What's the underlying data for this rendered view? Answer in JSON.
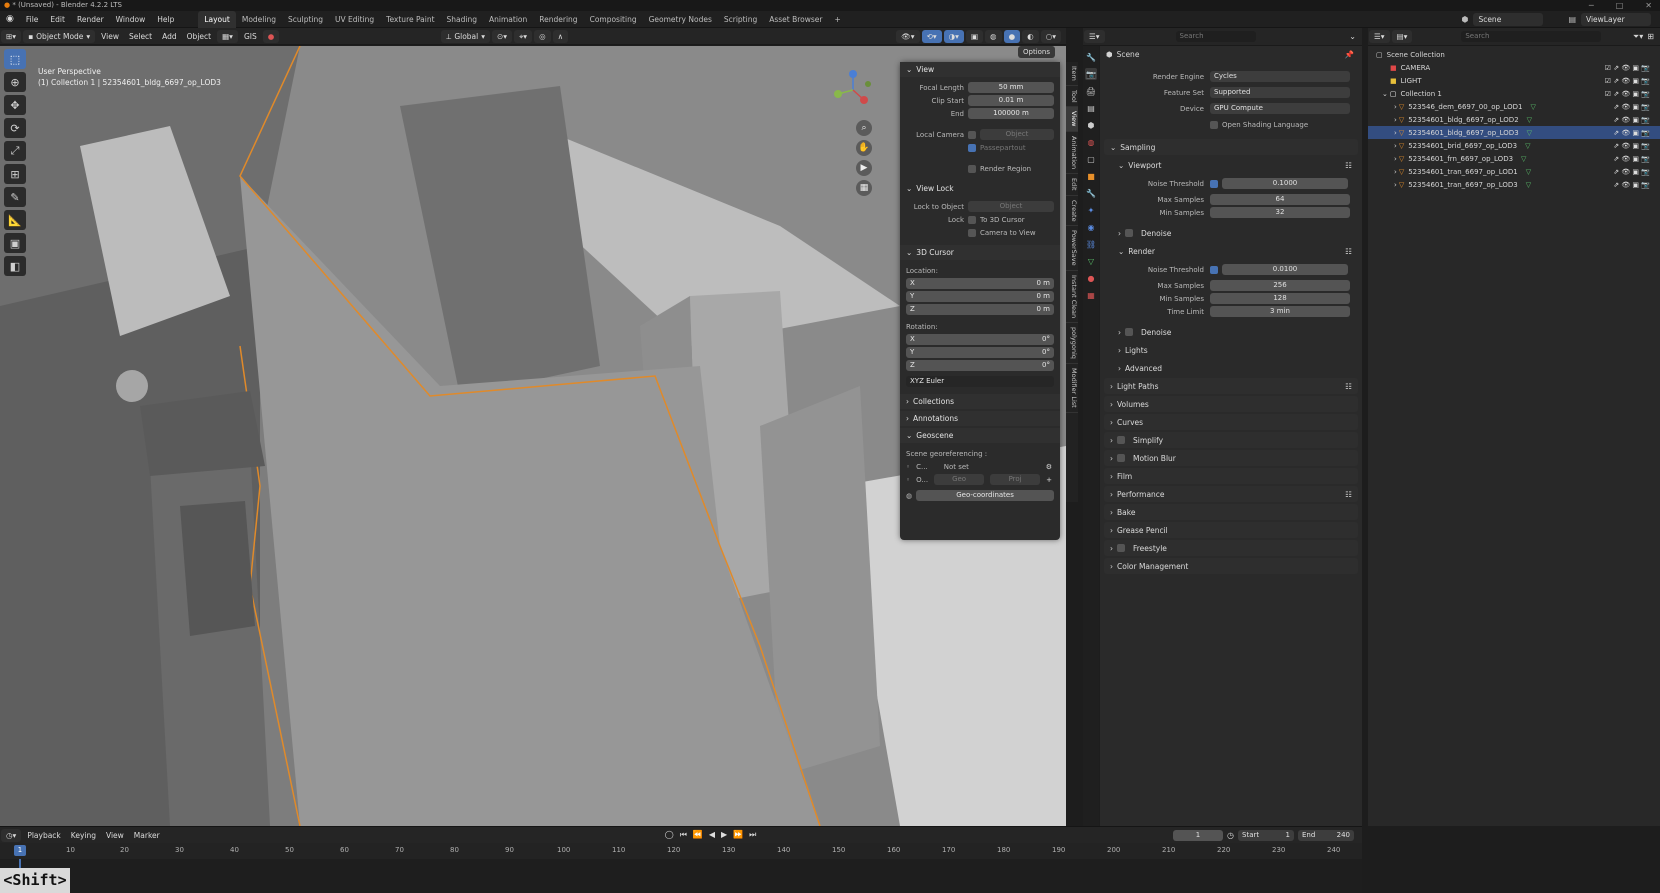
{
  "app": {
    "title": "* (Unsaved) - Blender 4.2.2 LTS"
  },
  "menu": {
    "items": [
      "File",
      "Edit",
      "Render",
      "Window",
      "Help"
    ],
    "workspaces": [
      "Layout",
      "Modeling",
      "Sculpting",
      "UV Editing",
      "Texture Paint",
      "Shading",
      "Animation",
      "Rendering",
      "Compositing",
      "Geometry Nodes",
      "Scripting",
      "Asset Browser"
    ],
    "active_workspace": "Layout",
    "scene_label": "Scene",
    "viewlayer_label": "ViewLayer"
  },
  "viewport_header": {
    "mode": "Object Mode",
    "menus": [
      "View",
      "Select",
      "Add",
      "Object"
    ],
    "gis": "GIS",
    "orientation": "Global",
    "options": "Options"
  },
  "viewport": {
    "perspective": "User Perspective",
    "collection_info": "(1) Collection 1 | 52354601_bldg_6697_op_LOD3"
  },
  "npanel": {
    "view_section": "View",
    "focal_length_label": "Focal Length",
    "focal_length": "50 mm",
    "clip_start_label": "Clip Start",
    "clip_start": "0.01 m",
    "end_label": "End",
    "clip_end": "100000 m",
    "local_camera_label": "Local Camera",
    "local_camera_placeholder": "Object",
    "passepartout": "Passepartout",
    "render_region": "Render Region",
    "view_lock_section": "View Lock",
    "lock_to_object_label": "Lock to Object",
    "lock_to_object_placeholder": "Object",
    "lock_label": "Lock",
    "to_3d_cursor": "To 3D Cursor",
    "camera_to_view": "Camera to View",
    "cursor_section": "3D Cursor",
    "location_label": "Location:",
    "loc_x": "0 m",
    "loc_y": "0 m",
    "loc_z": "0 m",
    "rotation_label": "Rotation:",
    "rot_x": "0°",
    "rot_y": "0°",
    "rot_z": "0°",
    "rotation_mode": "XYZ Euler",
    "collections_section": "Collections",
    "annotations_section": "Annotations",
    "geoscene_section": "Geoscene",
    "scene_georef_label": "Scene georeferencing :",
    "crs_short": "C...",
    "crs_value": "Not set",
    "origin_short": "O...",
    "geo_btn": "Geo",
    "proj_btn": "Proj",
    "geo_coordinates": "Geo-coordinates"
  },
  "sidebar_tabs": [
    "Item",
    "Tool",
    "View",
    "Animation",
    "Edit",
    "Create",
    "PowerSave",
    "Instant Clean",
    "polygoniq",
    "Modifier List"
  ],
  "active_sidebar_tab": "View",
  "properties": {
    "search_placeholder": "Search",
    "scene_label": "Scene",
    "render_engine_label": "Render Engine",
    "render_engine": "Cycles",
    "feature_set_label": "Feature Set",
    "feature_set": "Supported",
    "device_label": "Device",
    "device": "GPU Compute",
    "osl": "Open Shading Language",
    "sampling": "Sampling",
    "viewport": "Viewport",
    "noise_threshold_label": "Noise Threshold",
    "vp_noise": "0.1000",
    "max_samples_label": "Max Samples",
    "vp_max": "64",
    "min_samples_label": "Min Samples",
    "vp_min": "32",
    "denoise": "Denoise",
    "render": "Render",
    "r_noise": "0.0100",
    "r_max": "256",
    "r_min": "128",
    "time_limit_label": "Time Limit",
    "time_limit": "3 min",
    "lights": "Lights",
    "advanced": "Advanced",
    "sections": [
      "Light Paths",
      "Volumes",
      "Curves",
      "Simplify",
      "Motion Blur",
      "Film",
      "Performance",
      "Bake",
      "Grease Pencil",
      "Freestyle",
      "Color Management"
    ]
  },
  "outliner": {
    "search_placeholder": "Search",
    "root": "Scene Collection",
    "items": [
      {
        "name": "CAMERA",
        "indent": 1,
        "icon": "camera-icon"
      },
      {
        "name": "LIGHT",
        "indent": 1,
        "icon": "light-icon"
      },
      {
        "name": "Collection 1",
        "indent": 1,
        "icon": "collection-icon"
      },
      {
        "name": "523546_dem_6697_00_op_LOD1",
        "indent": 2,
        "icon": "mesh-icon"
      },
      {
        "name": "52354601_bldg_6697_op_LOD2",
        "indent": 2,
        "icon": "mesh-icon"
      },
      {
        "name": "52354601_bldg_6697_op_LOD3",
        "indent": 2,
        "icon": "mesh-icon",
        "selected": true
      },
      {
        "name": "52354601_brid_6697_op_LOD3",
        "indent": 2,
        "icon": "mesh-icon"
      },
      {
        "name": "52354601_frn_6697_op_LOD3",
        "indent": 2,
        "icon": "mesh-icon"
      },
      {
        "name": "52354601_tran_6697_op_LOD1",
        "indent": 2,
        "icon": "mesh-icon"
      },
      {
        "name": "52354601_tran_6697_op_LOD3",
        "indent": 2,
        "icon": "mesh-icon"
      }
    ]
  },
  "timeline": {
    "menus": [
      "Playback",
      "Keying",
      "View",
      "Marker"
    ],
    "current_frame": "1",
    "start_label": "Start",
    "start": "1",
    "end_label": "End",
    "end": "240",
    "ticks": [
      "1",
      "10",
      "20",
      "30",
      "40",
      "50",
      "60",
      "70",
      "80",
      "90",
      "100",
      "110",
      "120",
      "130",
      "140",
      "150",
      "160",
      "170",
      "180",
      "190",
      "200",
      "210",
      "220",
      "230",
      "240"
    ]
  },
  "overlay": {
    "key": "<Shift>"
  }
}
